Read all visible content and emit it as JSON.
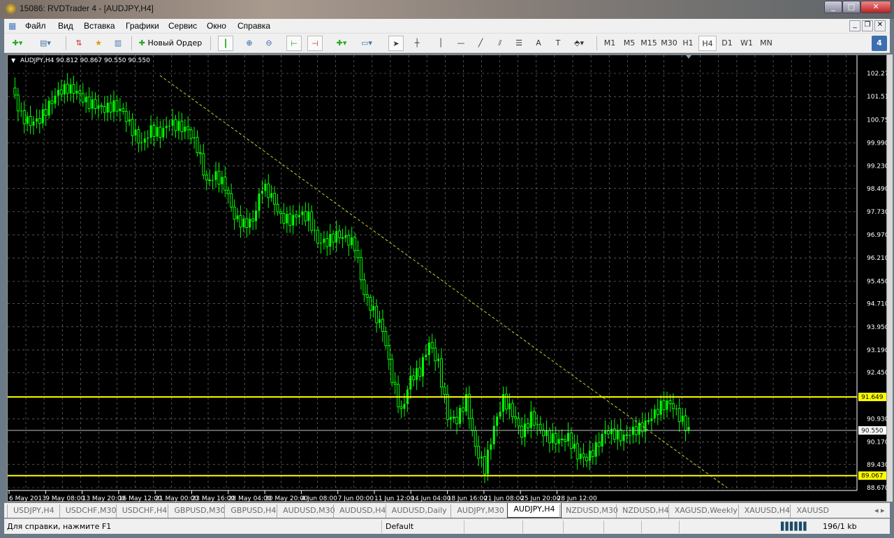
{
  "window": {
    "title": "15086: RVDTrader 4 - [AUDJPY,H4]"
  },
  "menu": [
    "Файл",
    "Вид",
    "Вставка",
    "Графики",
    "Сервис",
    "Окно",
    "Справка"
  ],
  "toolbar": {
    "new_order": "Новый Ордер",
    "timeframes": [
      "M1",
      "M5",
      "M15",
      "M30",
      "H1",
      "H4",
      "D1",
      "W1",
      "MN"
    ],
    "active_timeframe": "H4",
    "notifications": "4"
  },
  "chart_data": {
    "type": "candlestick",
    "title": "AUDJPY,H4  90.812 90.867 90.550 90.550",
    "ylim": [
      88.67,
      102.27
    ],
    "y_ticks": [
      "102.270",
      "101.510",
      "100.750",
      "99.990",
      "99.230",
      "98.490",
      "97.730",
      "96.970",
      "96.210",
      "95.450",
      "94.710",
      "93.950",
      "93.190",
      "92.450",
      "90.930",
      "90.170",
      "89.430",
      "88.670"
    ],
    "x_ticks": [
      "6 May 2013",
      "9 May 08:00",
      "13 May 20:00",
      "16 May 12:00",
      "21 May 00:00",
      "23 May 16:00",
      "28 May 04:00",
      "30 May 20:00",
      "4 Jun 08:00",
      "7 Jun 00:00",
      "11 Jun 12:00",
      "14 Jun 04:00",
      "18 Jun 16:00",
      "21 Jun 08:00",
      "25 Jun 20:00",
      "28 Jun 12:00"
    ],
    "closes": [
      101.79,
      100.87,
      100.64,
      100.76,
      101.22,
      101.67,
      101.79,
      101.67,
      101.33,
      101.22,
      101.1,
      101.22,
      100.99,
      100.41,
      99.95,
      100.41,
      100.3,
      100.64,
      100.53,
      100.41,
      99.84,
      98.69,
      98.92,
      98.58,
      97.55,
      97.32,
      97.44,
      98.58,
      98.23,
      97.55,
      97.44,
      97.66,
      97.55,
      96.74,
      96.74,
      96.97,
      96.86,
      96.63,
      95.02,
      94.45,
      93.87,
      92.27,
      91.12,
      92.27,
      92.5,
      93.42,
      92.73,
      91.0,
      90.89,
      91.58,
      89.98,
      89.3,
      90.66,
      91.58,
      91.12,
      90.43,
      91.0,
      90.54,
      90.32,
      90.2,
      90.32,
      89.75,
      89.63,
      89.98,
      90.54,
      90.43,
      90.32,
      90.54,
      90.66,
      91.0,
      91.35,
      91.46,
      91.0,
      90.55
    ],
    "horizontal_lines": [
      {
        "price": 91.649,
        "label": "91.649",
        "color": "#ffff00"
      },
      {
        "price": 89.067,
        "label": "89.067",
        "color": "#ffff00"
      },
      {
        "price": 90.55,
        "label": "90.550",
        "color": "#c0c0c0"
      }
    ],
    "trendline": {
      "from": 102.2,
      "to": 88.67,
      "color": "#cccc33"
    },
    "colors": {
      "bull": "#00ff00",
      "bear": "#00ff00",
      "background": "#000000",
      "grid": "#c0c0c0",
      "axis_text": "#ffffff"
    }
  },
  "tabs": [
    "USDJPY,H4",
    "USDCHF,M30",
    "USDCHF,H4",
    "GBPUSD,M30",
    "GBPUSD,H4",
    "AUDUSD,M30",
    "AUDUSD,H4",
    "AUDUSD,Daily",
    "AUDJPY,M30",
    "AUDJPY,H4",
    "NZDUSD,M30",
    "NZDUSD,H4",
    "XAGUSD,Weekly",
    "XAUUSD,H4",
    "XAUUSD"
  ],
  "active_tab": "AUDJPY,H4",
  "status": {
    "help": "Для справки, нажмите F1",
    "profile": "Default",
    "traffic": "196/1 kb"
  }
}
